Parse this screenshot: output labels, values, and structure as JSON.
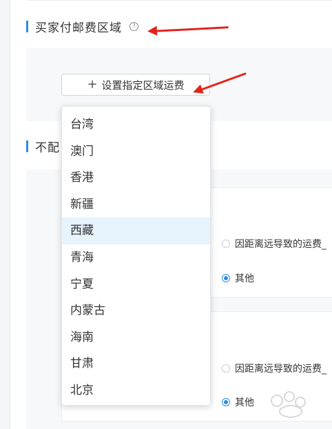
{
  "section1": {
    "title": "买家付邮费区域",
    "help_icon": "question-circle-icon"
  },
  "set_region_button": {
    "label": "设置指定区域运费",
    "icon": "plus-icon"
  },
  "section2": {
    "title_visible": "不配"
  },
  "dropdown": {
    "items": [
      "台湾",
      "澳门",
      "香港",
      "新疆",
      "西藏",
      "青海",
      "宁夏",
      "内蒙古",
      "海南",
      "甘肃",
      "北京"
    ],
    "highlighted": "西藏"
  },
  "card1": {
    "option1": "因距离远导致的运费_",
    "option2": "其他",
    "selected": "其他"
  },
  "card2": {
    "option1": "因距离远导致的运费_",
    "option2": "其他",
    "selected": "其他"
  },
  "colors": {
    "accent": "#2b8ce6",
    "annotation_arrow": "#e3231b",
    "highlight": "#e7f3fd"
  }
}
